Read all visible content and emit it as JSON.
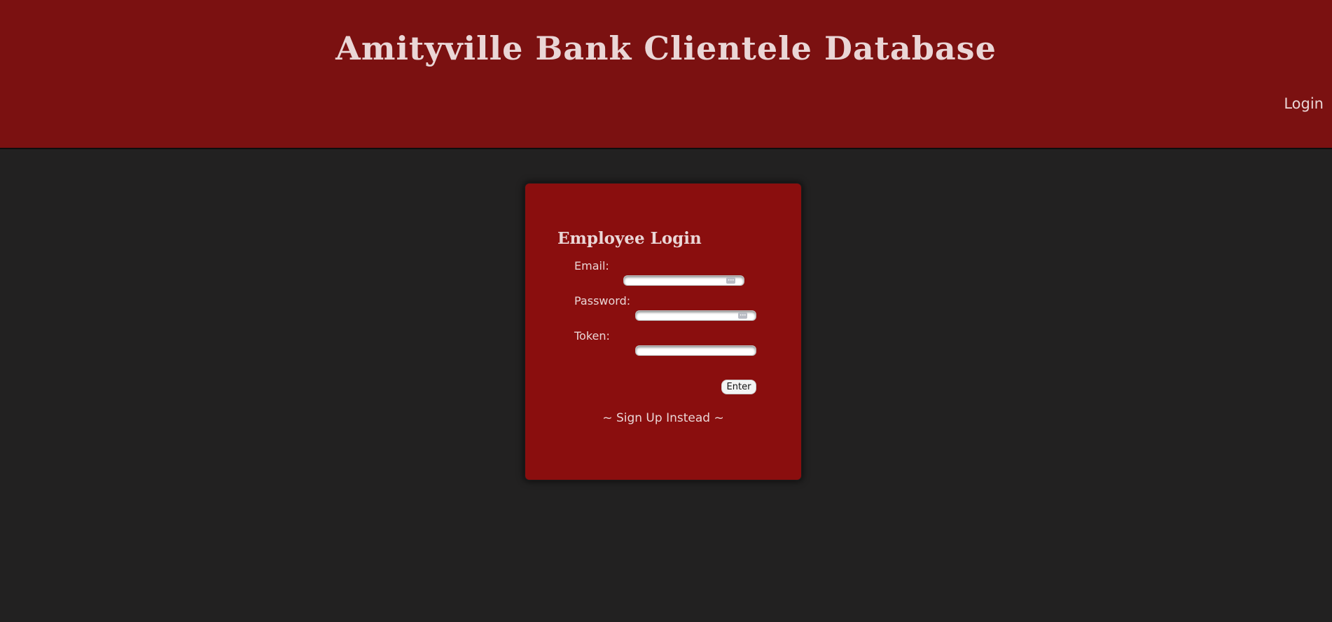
{
  "header": {
    "title": "Amityville Bank Clientele Database",
    "nav_login": "Login"
  },
  "login_card": {
    "title": "Employee Login",
    "fields": [
      {
        "label": "Email:",
        "value": "",
        "icon": "key-icon"
      },
      {
        "label": "Password:",
        "value": "",
        "icon": "key-icon"
      },
      {
        "label": "Token:",
        "value": ""
      }
    ],
    "enter_label": "Enter",
    "signup_label": "~ Sign Up Instead ~"
  },
  "colors": {
    "header_bg": "#7b1111",
    "page_bg": "#222121",
    "card_bg": "#8a0e0e",
    "text": "#ead6d6"
  }
}
